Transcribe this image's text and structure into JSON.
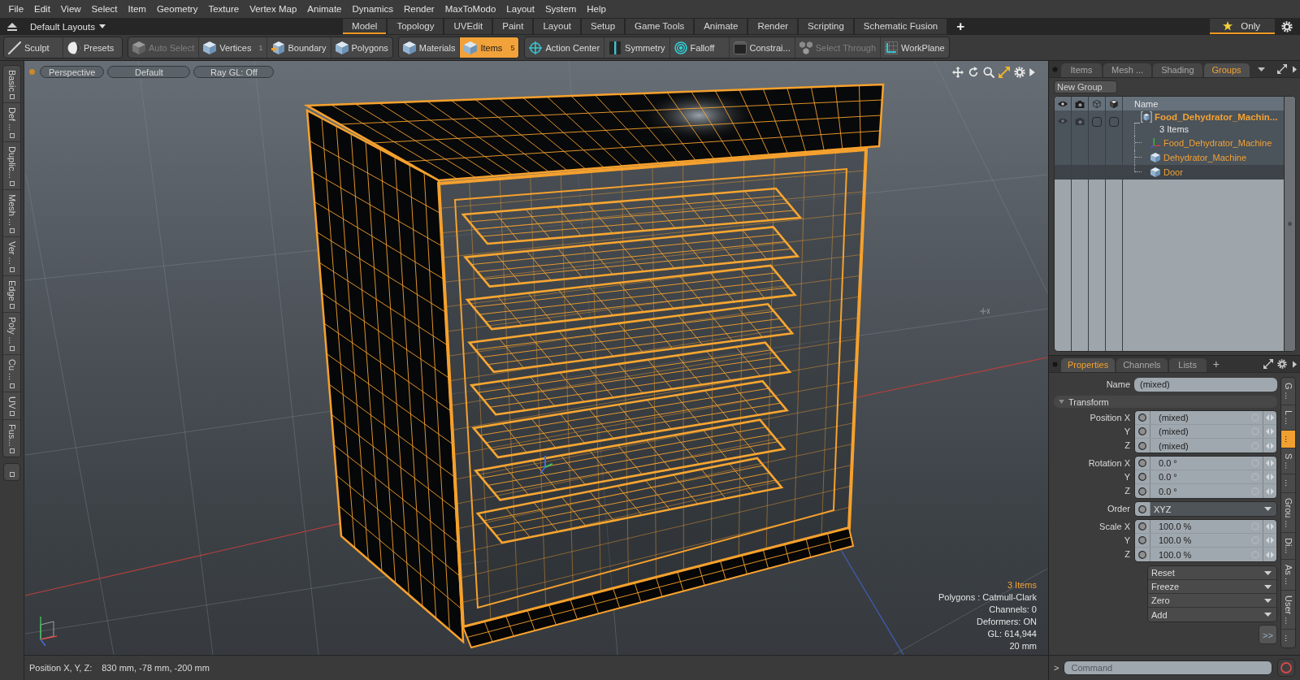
{
  "menu": [
    "File",
    "Edit",
    "View",
    "Select",
    "Item",
    "Geometry",
    "Texture",
    "Vertex Map",
    "Animate",
    "Dynamics",
    "Render",
    "MaxToModo",
    "Layout",
    "System",
    "Help"
  ],
  "layout_bar": {
    "layout_menu": "Default Layouts",
    "tabs": [
      {
        "label": "Model",
        "selected": true
      },
      {
        "label": "Topology",
        "selected": false
      },
      {
        "label": "UVEdit",
        "selected": false
      },
      {
        "label": "Paint",
        "selected": false
      },
      {
        "label": "Layout",
        "selected": false
      },
      {
        "label": "Setup",
        "selected": false
      },
      {
        "label": "Game Tools",
        "selected": false
      },
      {
        "label": "Animate",
        "selected": false
      },
      {
        "label": "Render",
        "selected": false
      },
      {
        "label": "Scripting",
        "selected": false
      },
      {
        "label": "Schematic Fusion",
        "selected": false
      }
    ],
    "add_tab": "+",
    "only_toggle": {
      "label": "Only",
      "on": true
    }
  },
  "toolbar": [
    [
      {
        "label": "Sculpt",
        "selected": false,
        "disabled": false
      },
      {
        "label": "Presets",
        "selected": false,
        "disabled": false
      }
    ],
    [
      {
        "label": "Auto Select",
        "selected": false,
        "disabled": true
      },
      {
        "label": "Vertices",
        "count": "1",
        "selected": false,
        "disabled": false
      },
      {
        "label": "Boundary",
        "selected": false,
        "disabled": false
      },
      {
        "label": "Polygons",
        "selected": false,
        "disabled": false
      }
    ],
    [
      {
        "label": "Materials",
        "selected": false,
        "disabled": false
      },
      {
        "label": "Items",
        "count": "5",
        "selected": true,
        "disabled": false
      }
    ],
    [
      {
        "label": "Action Center",
        "selected": false,
        "disabled": false
      },
      {
        "label": "Symmetry",
        "selected": false,
        "disabled": false
      },
      {
        "label": "Falloff",
        "selected": false,
        "disabled": false
      },
      {
        "label": "Constrai...",
        "selected": false,
        "disabled": false
      },
      {
        "label": "Select Through",
        "selected": false,
        "disabled": true
      },
      {
        "label": "WorkPlane",
        "selected": false,
        "disabled": false
      }
    ]
  ],
  "left_tabs": [
    "Basic",
    "Def ...",
    "Duplic...",
    "Mesh ...",
    "Ver ...",
    "Edge",
    "Poly ...",
    "Cu ...",
    "UV",
    "Fus..."
  ],
  "viewport": {
    "view_buttons": [
      "Perspective",
      "Default",
      "Ray GL: Off"
    ],
    "stats": [
      {
        "text": "3 Items",
        "highlighted": true
      },
      {
        "text": "Polygons : Catmull-Clark",
        "highlighted": false
      },
      {
        "text": "Channels: 0",
        "highlighted": false
      },
      {
        "text": "Deformers: ON",
        "highlighted": false
      },
      {
        "text": "GL: 614,944",
        "highlighted": false
      },
      {
        "text": "20 mm",
        "highlighted": false
      }
    ]
  },
  "status_bar": {
    "label": "Position X, Y, Z:",
    "value": "830 mm, -78 mm, -200 mm"
  },
  "item_panel": {
    "tabs": [
      {
        "label": "Items",
        "selected": false
      },
      {
        "label": "Mesh ...",
        "selected": false
      },
      {
        "label": "Shading",
        "selected": false
      },
      {
        "label": "Groups",
        "selected": true
      }
    ],
    "new_group": "New Group",
    "name_column": "Name",
    "tree": [
      {
        "name": "Food_Dehydrator_Machin...",
        "count": "3 Items",
        "selected": false,
        "children": [
          {
            "name": "Food_Dehydrator_Machine",
            "kind": "locator",
            "selected": false
          },
          {
            "name": "Dehydrator_Machine",
            "kind": "mesh",
            "selected": false
          },
          {
            "name": "Door",
            "kind": "mesh",
            "selected": true
          }
        ]
      }
    ]
  },
  "properties_panel": {
    "tabs": [
      {
        "label": "Properties",
        "selected": true
      },
      {
        "label": "Channels",
        "selected": false
      },
      {
        "label": "Lists",
        "selected": false
      }
    ],
    "add_tab": "+",
    "name": {
      "label": "Name",
      "value": "(mixed)"
    },
    "section": {
      "title": "Transform",
      "expanded": true
    },
    "field_groups": [
      [
        {
          "label": "Position X",
          "value": "(mixed)",
          "kind": "number"
        },
        {
          "label": "Y",
          "value": "(mixed)",
          "kind": "number"
        },
        {
          "label": "Z",
          "value": "(mixed)",
          "kind": "number"
        }
      ],
      [
        {
          "label": "Rotation X",
          "value": "0.0 °",
          "kind": "number"
        },
        {
          "label": "Y",
          "value": "0.0 °",
          "kind": "number"
        },
        {
          "label": "Z",
          "value": "0.0 °",
          "kind": "number"
        }
      ],
      [
        {
          "label": "Order",
          "value": "XYZ",
          "kind": "dropdown"
        }
      ],
      [
        {
          "label": "Scale X",
          "value": "100.0 %",
          "kind": "number"
        },
        {
          "label": "Y",
          "value": "100.0 %",
          "kind": "number"
        },
        {
          "label": "Z",
          "value": "100.0 %",
          "kind": "number"
        }
      ]
    ],
    "actions": [
      "Reset",
      "Freeze",
      "Zero",
      "Add"
    ],
    "more": ">>",
    "side_tabs": [
      {
        "label": "G ...",
        "selected": false
      },
      {
        "label": "L ...",
        "selected": false
      },
      {
        "label": "...",
        "selected": true
      },
      {
        "label": "S ...",
        "selected": false
      },
      {
        "label": "...",
        "selected": false
      },
      {
        "label": "Grou ...",
        "selected": false
      },
      {
        "label": "Di...",
        "selected": false
      },
      {
        "label": "As ...",
        "selected": false
      },
      {
        "label": "User ...",
        "selected": false
      },
      {
        "label": "...",
        "selected": false
      }
    ]
  },
  "command_bar": {
    "prompt": ">",
    "placeholder": "Command"
  }
}
